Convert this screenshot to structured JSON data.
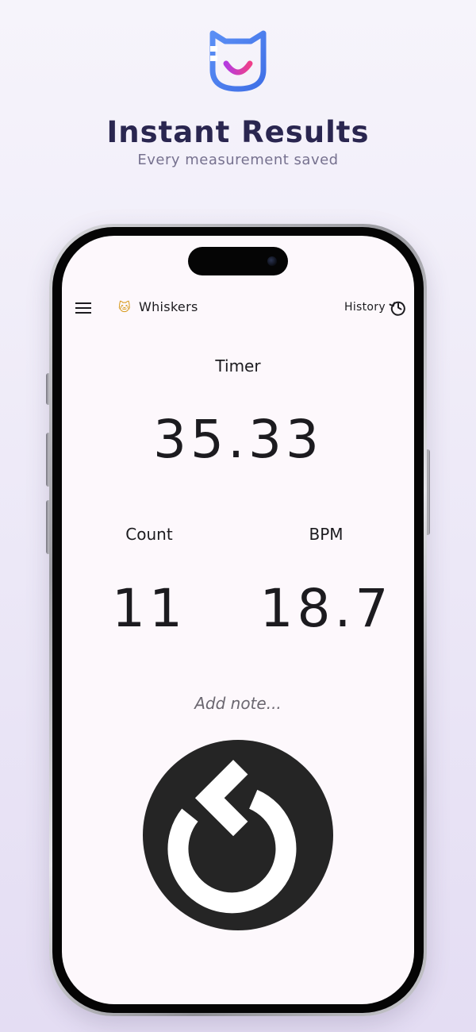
{
  "promo": {
    "headline": "Instant Results",
    "subheadline": "Every measurement saved",
    "logo_icon": "cat-face-logo-icon"
  },
  "app": {
    "appbar": {
      "menu_icon": "menu-icon",
      "pet_emoji": "🐱",
      "pet_name": "Whiskers",
      "history_label": "History",
      "history_icon": "history-icon"
    },
    "timer": {
      "label": "Timer",
      "value": "35.33"
    },
    "count": {
      "label": "Count",
      "value": "11"
    },
    "bpm": {
      "label": "BPM",
      "value": "18.7"
    },
    "note": {
      "placeholder": "Add note..."
    },
    "reset": {
      "icon": "reset-icon"
    }
  },
  "colors": {
    "headline": "#2a2650",
    "subheadline": "#76718f",
    "screen_background": "#fdf8fc",
    "text": "#1c1b1f",
    "reset_button": "#252525",
    "logo_blue": "#4d7cf0",
    "logo_pink": "#e0399a"
  }
}
